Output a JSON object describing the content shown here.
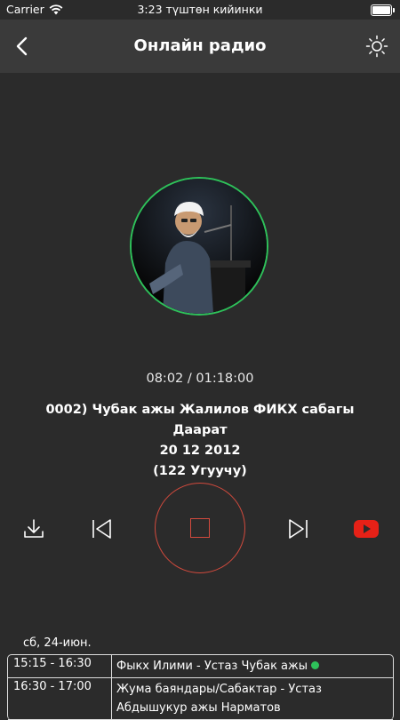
{
  "status_bar": {
    "carrier": "Carrier",
    "time": "3:23 түштөн кийинки"
  },
  "nav": {
    "title": "Онлайн радио",
    "back_icon": "chevron-left-icon",
    "theme_icon": "sun-icon"
  },
  "player": {
    "time": "08:02 / 01:18:00",
    "title_line1": "0002) Чубак ажы Жалилов ФИКХ сабагы Даарат",
    "title_line2": "20 12 2012",
    "title_line3": "(122 Угуучу)",
    "controls": [
      "download-icon",
      "previous-icon",
      "stop-icon",
      "next-icon",
      "youtube-icon"
    ],
    "colors": {
      "accent": "#d24a3d",
      "live": "#2ec15a",
      "youtube": "#e62117"
    }
  },
  "schedule": {
    "date": "сб, 24-июн.",
    "rows": [
      {
        "time": "15:15 - 16:30",
        "name": "Фыкх Илими - Устаз Чубак ажы",
        "live": true
      },
      {
        "time": "16:30 - 17:00",
        "name": "Жума баяндары/Сабактар - Устаз Абдышукур ажы Нарматов",
        "live": false
      }
    ]
  }
}
